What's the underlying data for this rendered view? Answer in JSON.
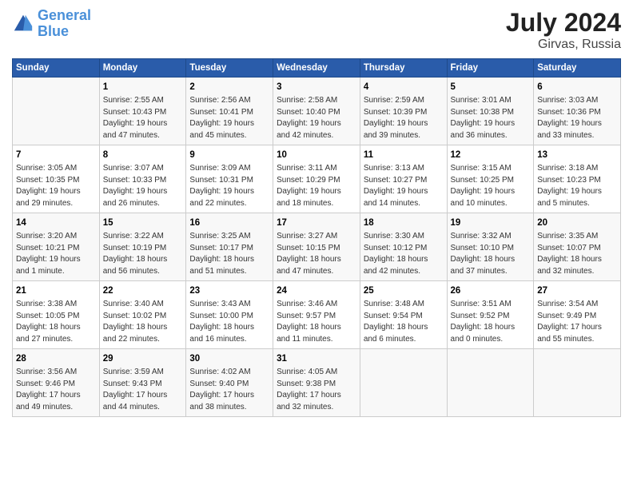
{
  "header": {
    "logo_line1": "General",
    "logo_line2": "Blue",
    "main_title": "July 2024",
    "subtitle": "Girvas, Russia"
  },
  "days_of_week": [
    "Sunday",
    "Monday",
    "Tuesday",
    "Wednesday",
    "Thursday",
    "Friday",
    "Saturday"
  ],
  "weeks": [
    [
      {
        "num": "",
        "info": ""
      },
      {
        "num": "1",
        "info": "Sunrise: 2:55 AM\nSunset: 10:43 PM\nDaylight: 19 hours\nand 47 minutes."
      },
      {
        "num": "2",
        "info": "Sunrise: 2:56 AM\nSunset: 10:41 PM\nDaylight: 19 hours\nand 45 minutes."
      },
      {
        "num": "3",
        "info": "Sunrise: 2:58 AM\nSunset: 10:40 PM\nDaylight: 19 hours\nand 42 minutes."
      },
      {
        "num": "4",
        "info": "Sunrise: 2:59 AM\nSunset: 10:39 PM\nDaylight: 19 hours\nand 39 minutes."
      },
      {
        "num": "5",
        "info": "Sunrise: 3:01 AM\nSunset: 10:38 PM\nDaylight: 19 hours\nand 36 minutes."
      },
      {
        "num": "6",
        "info": "Sunrise: 3:03 AM\nSunset: 10:36 PM\nDaylight: 19 hours\nand 33 minutes."
      }
    ],
    [
      {
        "num": "7",
        "info": "Sunrise: 3:05 AM\nSunset: 10:35 PM\nDaylight: 19 hours\nand 29 minutes."
      },
      {
        "num": "8",
        "info": "Sunrise: 3:07 AM\nSunset: 10:33 PM\nDaylight: 19 hours\nand 26 minutes."
      },
      {
        "num": "9",
        "info": "Sunrise: 3:09 AM\nSunset: 10:31 PM\nDaylight: 19 hours\nand 22 minutes."
      },
      {
        "num": "10",
        "info": "Sunrise: 3:11 AM\nSunset: 10:29 PM\nDaylight: 19 hours\nand 18 minutes."
      },
      {
        "num": "11",
        "info": "Sunrise: 3:13 AM\nSunset: 10:27 PM\nDaylight: 19 hours\nand 14 minutes."
      },
      {
        "num": "12",
        "info": "Sunrise: 3:15 AM\nSunset: 10:25 PM\nDaylight: 19 hours\nand 10 minutes."
      },
      {
        "num": "13",
        "info": "Sunrise: 3:18 AM\nSunset: 10:23 PM\nDaylight: 19 hours\nand 5 minutes."
      }
    ],
    [
      {
        "num": "14",
        "info": "Sunrise: 3:20 AM\nSunset: 10:21 PM\nDaylight: 19 hours\nand 1 minute."
      },
      {
        "num": "15",
        "info": "Sunrise: 3:22 AM\nSunset: 10:19 PM\nDaylight: 18 hours\nand 56 minutes."
      },
      {
        "num": "16",
        "info": "Sunrise: 3:25 AM\nSunset: 10:17 PM\nDaylight: 18 hours\nand 51 minutes."
      },
      {
        "num": "17",
        "info": "Sunrise: 3:27 AM\nSunset: 10:15 PM\nDaylight: 18 hours\nand 47 minutes."
      },
      {
        "num": "18",
        "info": "Sunrise: 3:30 AM\nSunset: 10:12 PM\nDaylight: 18 hours\nand 42 minutes."
      },
      {
        "num": "19",
        "info": "Sunrise: 3:32 AM\nSunset: 10:10 PM\nDaylight: 18 hours\nand 37 minutes."
      },
      {
        "num": "20",
        "info": "Sunrise: 3:35 AM\nSunset: 10:07 PM\nDaylight: 18 hours\nand 32 minutes."
      }
    ],
    [
      {
        "num": "21",
        "info": "Sunrise: 3:38 AM\nSunset: 10:05 PM\nDaylight: 18 hours\nand 27 minutes."
      },
      {
        "num": "22",
        "info": "Sunrise: 3:40 AM\nSunset: 10:02 PM\nDaylight: 18 hours\nand 22 minutes."
      },
      {
        "num": "23",
        "info": "Sunrise: 3:43 AM\nSunset: 10:00 PM\nDaylight: 18 hours\nand 16 minutes."
      },
      {
        "num": "24",
        "info": "Sunrise: 3:46 AM\nSunset: 9:57 PM\nDaylight: 18 hours\nand 11 minutes."
      },
      {
        "num": "25",
        "info": "Sunrise: 3:48 AM\nSunset: 9:54 PM\nDaylight: 18 hours\nand 6 minutes."
      },
      {
        "num": "26",
        "info": "Sunrise: 3:51 AM\nSunset: 9:52 PM\nDaylight: 18 hours\nand 0 minutes."
      },
      {
        "num": "27",
        "info": "Sunrise: 3:54 AM\nSunset: 9:49 PM\nDaylight: 17 hours\nand 55 minutes."
      }
    ],
    [
      {
        "num": "28",
        "info": "Sunrise: 3:56 AM\nSunset: 9:46 PM\nDaylight: 17 hours\nand 49 minutes."
      },
      {
        "num": "29",
        "info": "Sunrise: 3:59 AM\nSunset: 9:43 PM\nDaylight: 17 hours\nand 44 minutes."
      },
      {
        "num": "30",
        "info": "Sunrise: 4:02 AM\nSunset: 9:40 PM\nDaylight: 17 hours\nand 38 minutes."
      },
      {
        "num": "31",
        "info": "Sunrise: 4:05 AM\nSunset: 9:38 PM\nDaylight: 17 hours\nand 32 minutes."
      },
      {
        "num": "",
        "info": ""
      },
      {
        "num": "",
        "info": ""
      },
      {
        "num": "",
        "info": ""
      }
    ]
  ]
}
